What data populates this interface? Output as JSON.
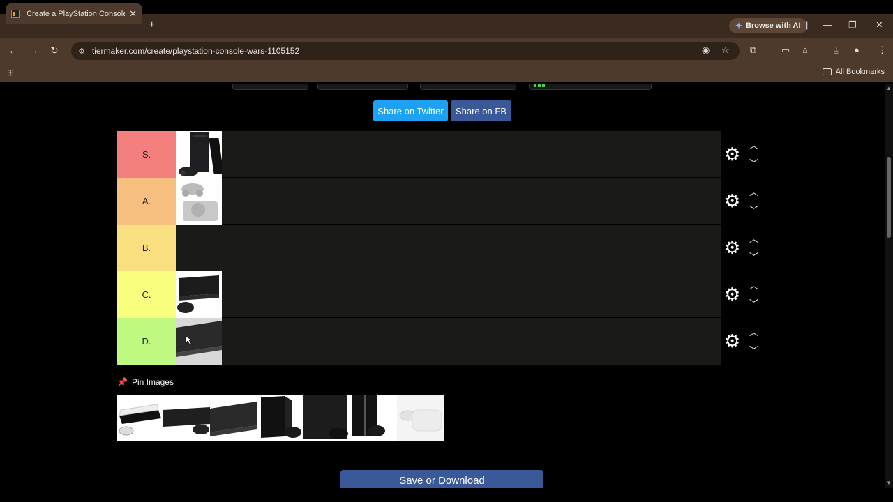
{
  "browser": {
    "tab_title": "Create a PlayStation Console W",
    "url": "tiermaker.com/create/playstation-console-wars-1105152",
    "browse_ai_label": "Browse with AI",
    "all_bookmarks_label": "All Bookmarks"
  },
  "page": {
    "share_twitter": "Share on Twitter",
    "share_fb": "Share on FB",
    "tiers": [
      {
        "label": "S.",
        "color": "#f47f7f"
      },
      {
        "label": "A.",
        "color": "#f7bf7f"
      },
      {
        "label": "B.",
        "color": "#f9df7f"
      },
      {
        "label": "C.",
        "color": "#f9fe7f"
      },
      {
        "label": "D.",
        "color": "#bff97f"
      }
    ],
    "pin_images_label": "Pin Images",
    "save_button": "Save or Download"
  },
  "icons": [
    "gear-icon",
    "chevron-up-icon",
    "chevron-down-icon",
    "pin-icon",
    "close-icon",
    "back-icon",
    "forward-icon",
    "reload-icon"
  ]
}
